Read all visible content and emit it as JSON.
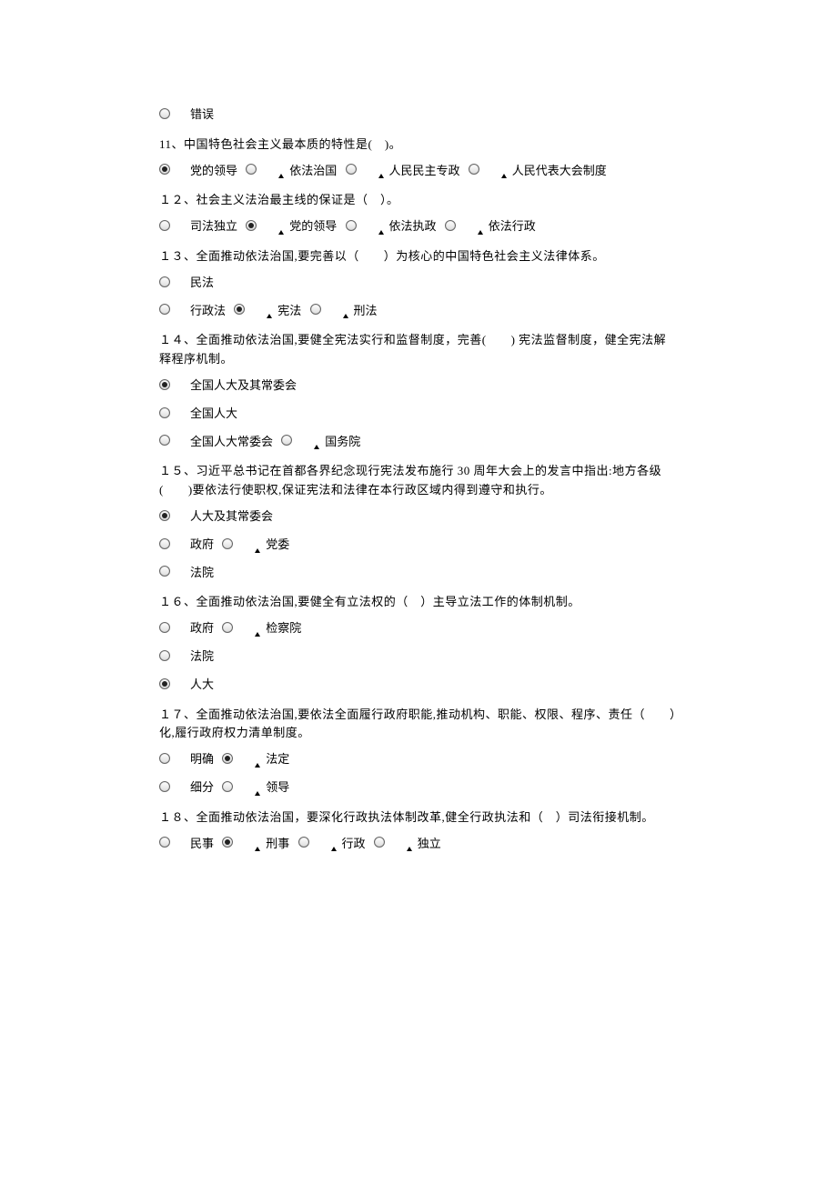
{
  "q10b": {
    "opt1": "错误"
  },
  "q11": {
    "text": "11、中国特色社会主义最本质的特性是(　)。",
    "a": "党的领导",
    "b": "依法治国",
    "c": "人民民主专政",
    "d": "人民代表大会制度"
  },
  "q12": {
    "text": "１２、社会主义法治最主线的保证是（　）。",
    "a": "司法独立",
    "b": "党的领导",
    "c": "依法执政",
    "d": "依法行政"
  },
  "q13": {
    "text": "１３、全面推动依法治国,要完善以（　　）为核心的中国特色社会主义法律体系。",
    "a": "民法",
    "b": "行政法",
    "c": "宪法",
    "d": "刑法"
  },
  "q14": {
    "text": "１４、全面推动依法治国,要健全宪法实行和监督制度，完善(　　) 宪法监督制度，健全宪法解释程序机制。",
    "a": "全国人大及其常委会",
    "b": "全国人大",
    "c": "全国人大常委会",
    "d": "国务院"
  },
  "q15": {
    "text": "１５、习近平总书记在首都各界纪念现行宪法发布施行 30 周年大会上的发言中指出:地方各级(　　)要依法行使职权,保证宪法和法律在本行政区域内得到遵守和执行。",
    "a": "人大及其常委会",
    "b": "政府",
    "c": "党委",
    "d": "法院"
  },
  "q16": {
    "text": "１６、全面推动依法治国,要健全有立法权的（　）主导立法工作的体制机制。",
    "a": "政府",
    "b": "检察院",
    "c": "法院",
    "d": "人大"
  },
  "q17": {
    "text": "１７、全面推动依法治国,要依法全面履行政府职能,推动机构、职能、权限、程序、责任（　　）化,履行政府权力清单制度。",
    "a": "明确",
    "b": "法定",
    "c": "细分",
    "d": "领导"
  },
  "q18": {
    "text": "１８、全面推动依法治国，要深化行政执法体制改革,健全行政执法和（　）司法衔接机制。",
    "a": "民事",
    "b": "刑事",
    "c": "行政",
    "d": "独立"
  }
}
